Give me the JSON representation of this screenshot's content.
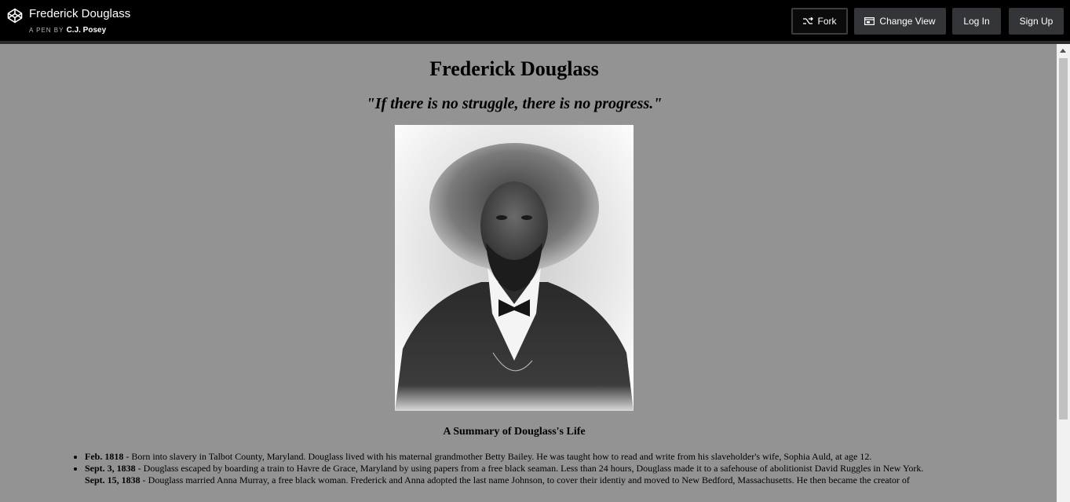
{
  "header": {
    "pen_title": "Frederick Douglass",
    "author_prefix": "A PEN BY",
    "author_name": "C.J. Posey",
    "fork_label": "Fork",
    "change_view_label": "Change View",
    "login_label": "Log In",
    "signup_label": "Sign Up",
    "logo_icon": "codepen-logo-icon",
    "fork_icon": "fork-icon",
    "view_icon": "change-view-icon"
  },
  "main": {
    "title": "Frederick Douglass",
    "quote": "\"If there is no struggle, there is no progress.\"",
    "image_alt": "Portrait of Frederick Douglass",
    "summary_heading": "A Summary of Douglass's Life",
    "timeline": [
      {
        "date": "Feb. 1818",
        "text": " - Born into slavery in Talbot County, Maryland. Douglass lived with his maternal grandmother Betty Bailey. He was taught how to read and write from his slaveholder's wife, Sophia Auld, at age 12."
      },
      {
        "date": "Sept. 3, 1838",
        "text": " - Douglass escaped by boarding a train to Havre de Grace, Maryland by using papers from a free black seaman. Less than 24 hours, Douglass made it to a safehouse of abolitionist David Ruggles in New York."
      },
      {
        "date": "Sept. 15, 1838",
        "text": " - Douglass married Anna Murray, a free black woman. Frederick and Anna adopted the last name Johnson, to cover their identiy and moved to New Bedford, Massachusetts. He then became the creator of"
      }
    ]
  },
  "colors": {
    "topbar_bg": "#000000",
    "page_bg": "#939393",
    "button_bg": "#333539"
  }
}
